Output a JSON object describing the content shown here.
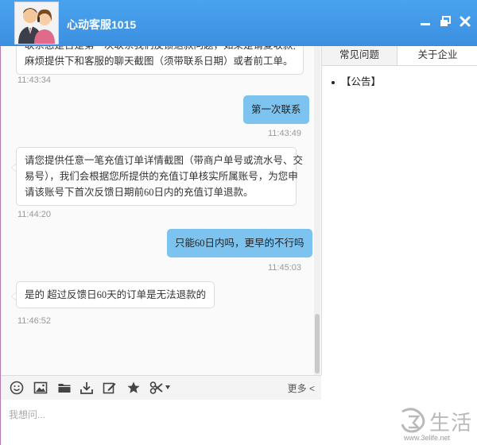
{
  "window": {
    "title": "心动客服1015",
    "controls": [
      "minimize-icon",
      "restore-icon",
      "close-icon"
    ]
  },
  "messages": [
    {
      "dir": "in",
      "lines": [
        "联系您是否是第一次联系我们反馈退款问题，如果是请复收款并",
        "麻烦提供下和客服的聊天截图（须带联系日期）或者前工单。"
      ],
      "time": "11:43:34"
    },
    {
      "dir": "out",
      "lines": [
        "第一次联系"
      ],
      "time": "11:43:49"
    },
    {
      "dir": "in",
      "lines": [
        "请您提供任意一笔充值订单详情截图（带商户单号或流水号、交",
        "易号），我们会根据您所提供的充值订单核实所属账号，为您申",
        "请该账号下首次反馈日期前60日内的充值订单退款。"
      ],
      "time": "11:44:20"
    },
    {
      "dir": "out",
      "lines": [
        "只能60日内吗，更早的不行吗"
      ],
      "time": "11:45:03"
    },
    {
      "dir": "in",
      "lines": [
        "是的 超过反馈日60天的订单是无法退款的"
      ],
      "time": "11:46:52"
    }
  ],
  "toolbar": {
    "tools": [
      "emoji-icon",
      "image-icon",
      "folder-icon",
      "download-icon",
      "edit-icon",
      "star-icon",
      "scissors-icon"
    ],
    "more_label": "更多 <"
  },
  "input": {
    "placeholder": "我想问...",
    "value": ""
  },
  "right_panel": {
    "tabs": [
      {
        "label": "常见问题",
        "active": true
      },
      {
        "label": "关于企业",
        "active": false
      }
    ],
    "notice": "【公告】"
  },
  "watermark": {
    "text": "生活",
    "url": "www.3elife.net"
  },
  "colors": {
    "titlebar": "#3b8fe0",
    "outgoing_bubble": "#7cc3f0",
    "accent_border": "#b678b8"
  }
}
